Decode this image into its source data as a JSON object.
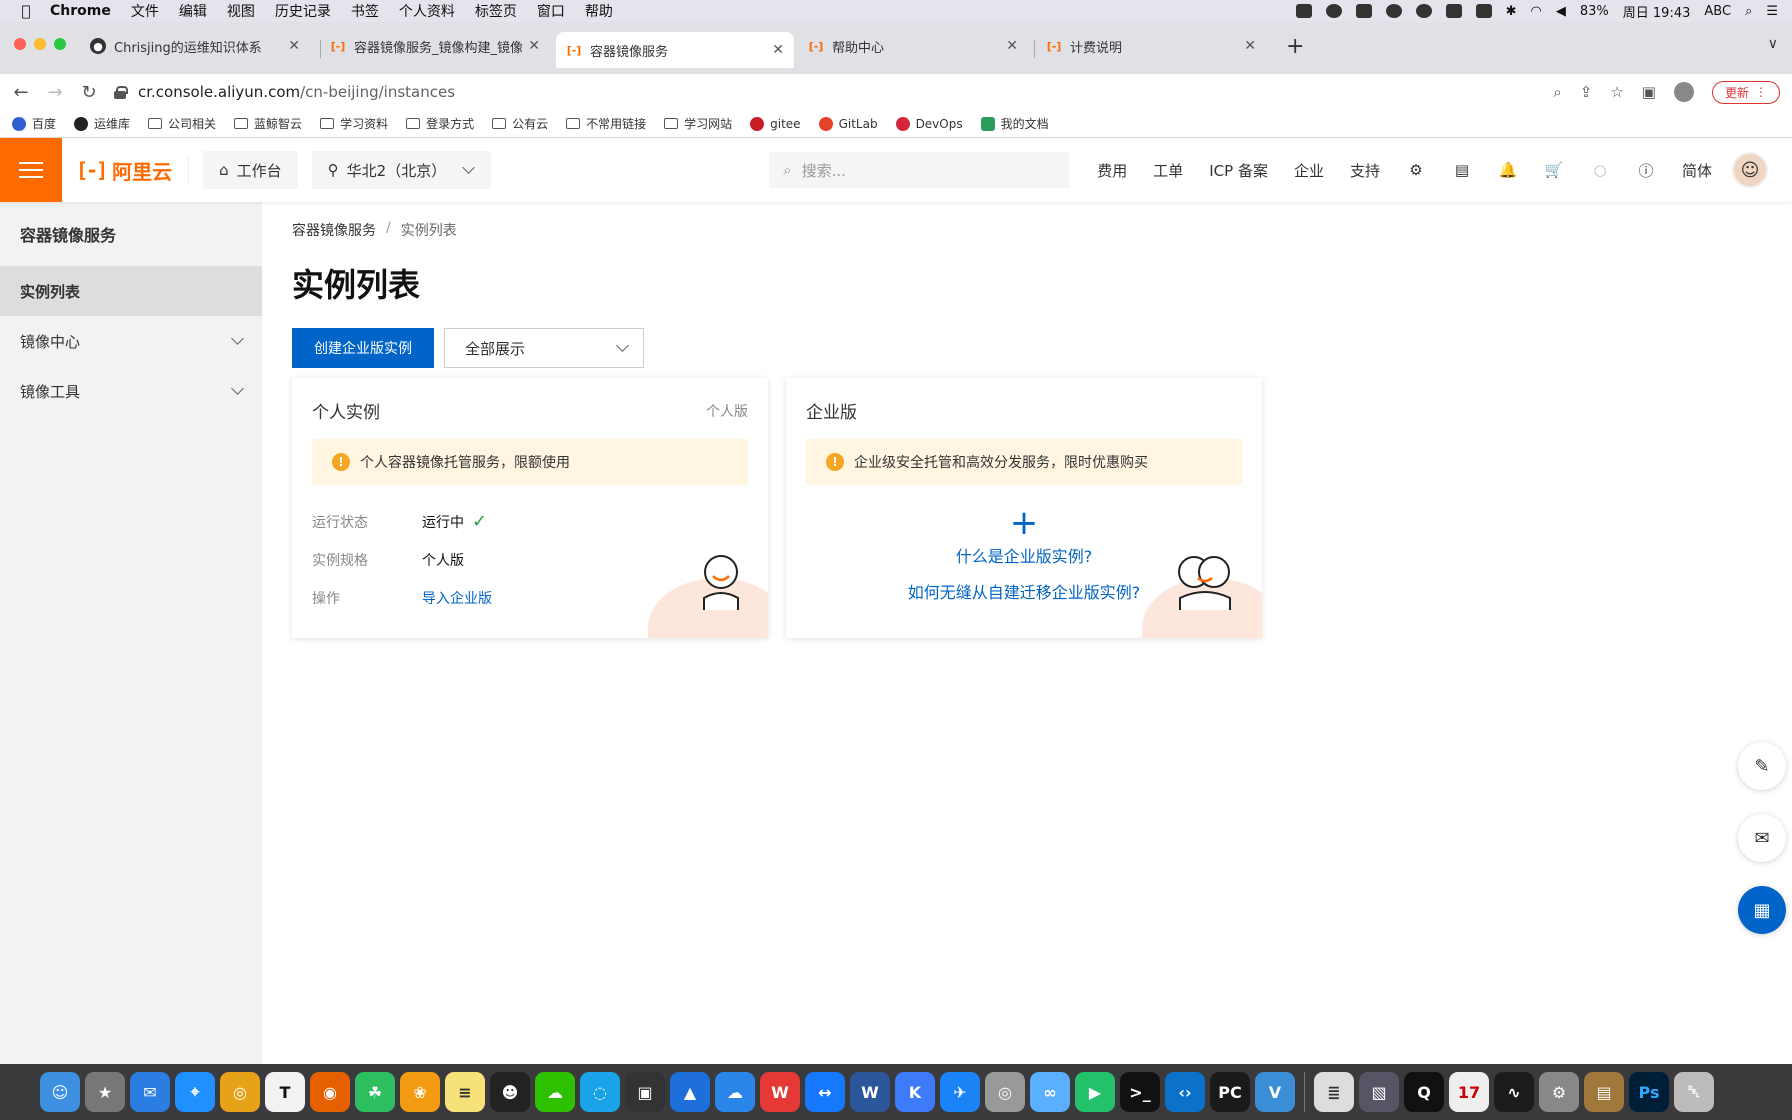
{
  "menubar": {
    "app": "Chrome",
    "items": [
      "文件",
      "编辑",
      "视图",
      "历史记录",
      "书签",
      "个人资料",
      "标签页",
      "窗口",
      "帮助"
    ],
    "battery": "83%",
    "clock": "周日 19:43",
    "input_method": "ABC"
  },
  "tabs": [
    {
      "title": "Chrisjing的运维知识体系"
    },
    {
      "title": "容器镜像服务_镜像构建_镜像授权"
    },
    {
      "title": "容器镜像服务"
    },
    {
      "title": "帮助中心"
    },
    {
      "title": "计费说明"
    }
  ],
  "address": {
    "host": "cr.console.aliyun.com",
    "path": "/cn-beijing/instances"
  },
  "update_label": "更新",
  "bookmarks": [
    "百度",
    "运维库",
    "公司相关",
    "蓝鲸智云",
    "学习资料",
    "登录方式",
    "公有云",
    "不常用链接",
    "学习网站",
    "gitee",
    "GitLab",
    "DevOps",
    "我的文档"
  ],
  "topnav": {
    "logo": "阿里云",
    "workbench": "工作台",
    "region": "华北2（北京）",
    "search_placeholder": "搜索...",
    "links": [
      "费用",
      "工单",
      "ICP 备案",
      "企业",
      "支持"
    ],
    "lang": "简体"
  },
  "sidebar": {
    "title": "容器镜像服务",
    "items": [
      {
        "label": "实例列表"
      },
      {
        "label": "镜像中心"
      },
      {
        "label": "镜像工具"
      }
    ]
  },
  "breadcrumb": {
    "root": "容器镜像服务",
    "current": "实例列表"
  },
  "page_title": "实例列表",
  "actions": {
    "create": "创建企业版实例",
    "filter": "全部展示"
  },
  "personal_card": {
    "title": "个人实例",
    "tag": "个人版",
    "notice": "个人容器镜像托管服务，限额使用",
    "status_label": "运行状态",
    "status_value": "运行中",
    "spec_label": "实例规格",
    "spec_value": "个人版",
    "op_label": "操作",
    "op_value": "导入企业版"
  },
  "enterprise_card": {
    "title": "企业版",
    "notice": "企业级安全托管和高效分发服务，限时优惠购买",
    "link1": "什么是企业版实例?",
    "link2": "如何无缝从自建迁移企业版实例?"
  },
  "colors": {
    "accent": "#ff6a00",
    "primary": "#0064c8",
    "notice_bg": "#fff5e1",
    "success": "#2e9e44"
  }
}
